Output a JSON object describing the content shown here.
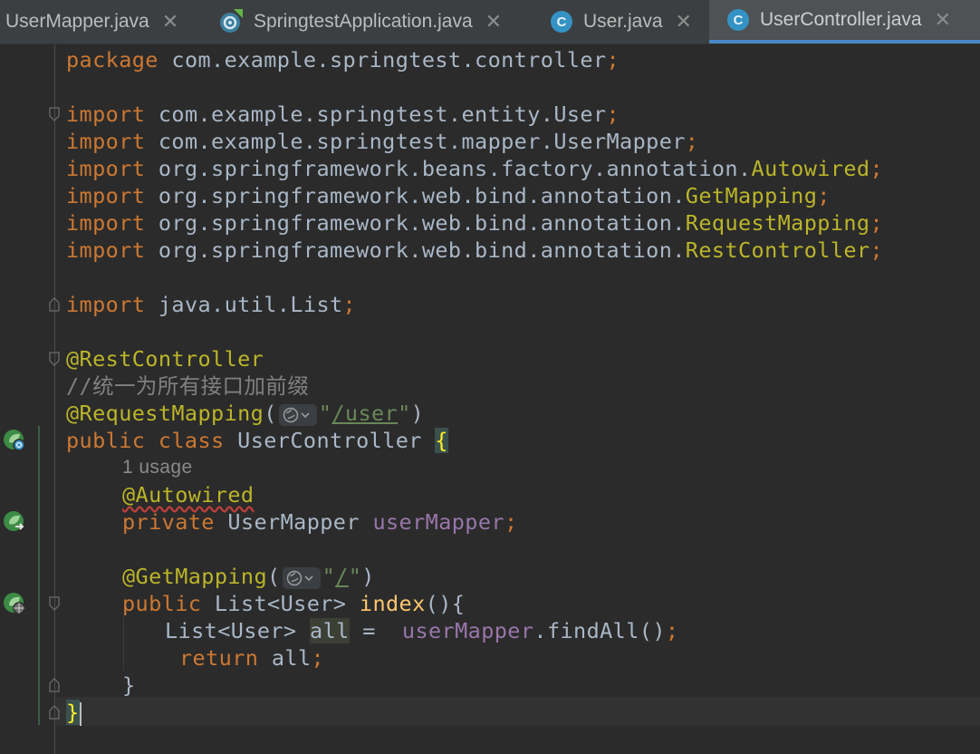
{
  "tabs": [
    {
      "name": "UserMapper.java",
      "icon": "interface-file-icon",
      "active": false
    },
    {
      "name": "SpringtestApplication.java",
      "icon": "spring-boot-icon",
      "active": false
    },
    {
      "name": "User.java",
      "icon": "class-file-icon",
      "active": false
    },
    {
      "name": "UserController.java",
      "icon": "class-file-icon",
      "active": true
    }
  ],
  "tab_close_glyph": "✕",
  "class_icon_letter": "C",
  "code": {
    "package_kw": "package",
    "package_name": "com.example.springtest.controller",
    "import_kw": "import",
    "imports": [
      {
        "path": "com.example.springtest.entity.",
        "cls": "User",
        "cls_highlight": false
      },
      {
        "path": "com.example.springtest.mapper.",
        "cls": "UserMapper",
        "cls_highlight": false
      },
      {
        "path": "org.springframework.beans.factory.annotation.",
        "cls": "Autowired",
        "cls_highlight": true
      },
      {
        "path": "org.springframework.web.bind.annotation.",
        "cls": "GetMapping",
        "cls_highlight": true
      },
      {
        "path": "org.springframework.web.bind.annotation.",
        "cls": "RequestMapping",
        "cls_highlight": true
      },
      {
        "path": "org.springframework.web.bind.annotation.",
        "cls": "RestController",
        "cls_highlight": true
      }
    ],
    "import_list": "java.util.List",
    "semicolon": ";",
    "rest_controller": "@RestController",
    "comment": "//统一为所有接口加前缀",
    "request_mapping": "@RequestMapping",
    "request_mapping_value": "/user",
    "class_decl_kw": "public class",
    "class_name": "UserController",
    "usage_hint": "1 usage",
    "autowired": "@Autowired",
    "private_kw": "private",
    "field_type": "UserMapper",
    "field_name": "userMapper",
    "get_mapping": "@GetMapping",
    "get_mapping_value": "/",
    "public_kw": "public",
    "return_type": "List<User>",
    "method_name": "index",
    "local_type": "List<User>",
    "local_var": "all",
    "assign": " =  ",
    "call_target": "userMapper",
    "call": ".findAll()",
    "return_kw": "return",
    "return_var": "all"
  },
  "colors": {
    "background": "#2b2b2b",
    "keyword": "#cc7832",
    "annotation": "#bbb529",
    "string": "#6a8759",
    "comment": "#808080",
    "field": "#9876aa",
    "method": "#ffc66d",
    "default_text": "#a9b7c6",
    "active_tab_underline": "#4a88c7"
  }
}
